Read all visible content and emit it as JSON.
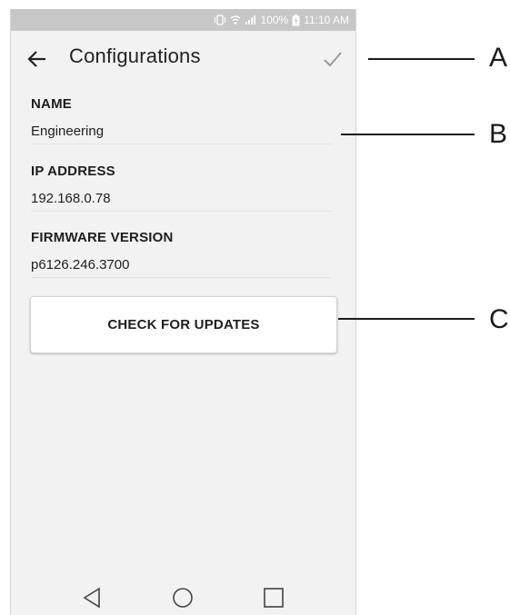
{
  "status_bar": {
    "battery": "100%",
    "time": "11:10 AM"
  },
  "app_bar": {
    "title": "Configurations",
    "back_icon": "arrow-left-icon",
    "confirm_icon": "checkmark-icon"
  },
  "fields": [
    {
      "label": "NAME",
      "value": "Engineering"
    },
    {
      "label": "IP ADDRESS",
      "value": "192.168.0.78"
    },
    {
      "label": "FIRMWARE VERSION",
      "value": "p6126.246.3700"
    }
  ],
  "actions": {
    "check_updates_label": "CHECK FOR UPDATES"
  },
  "nav_bar": {
    "icons": [
      "back-triangle-icon",
      "home-circle-icon",
      "recents-square-icon"
    ]
  },
  "callouts": [
    "A",
    "B",
    "C"
  ],
  "colors": {
    "status_bar_bg": "#c7c7c7",
    "screen_bg": "#f2f2f2",
    "text": "#1e1e1e",
    "button_bg": "#ffffff"
  }
}
